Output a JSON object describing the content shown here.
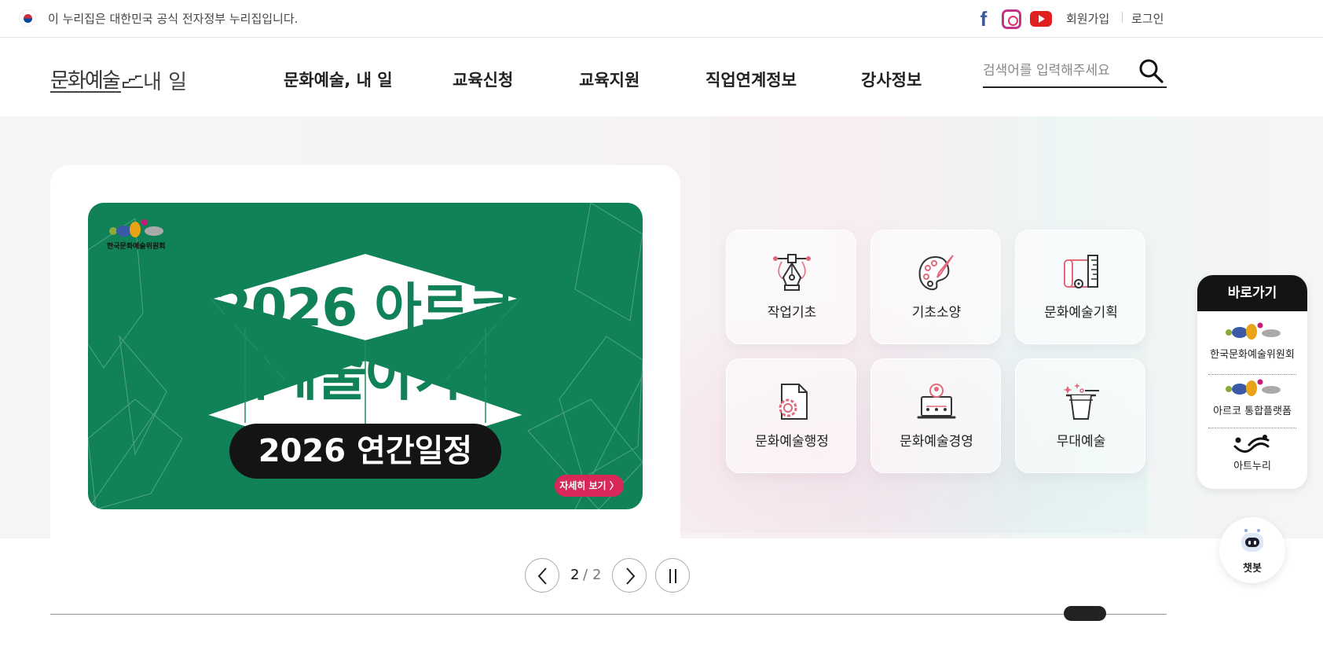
{
  "govbar": {
    "notice": "이 누리집은 대한민국 공식 전자정부 누리집입니다.",
    "sns": [
      "facebook-icon",
      "instagram-icon",
      "youtube-icon"
    ],
    "join_label": "회원가입",
    "login_label": "로그인"
  },
  "header": {
    "logo_text_1": "문화예술",
    "logo_text_2": "내 일",
    "nav": [
      "문화예술, 내 일",
      "교육신청",
      "교육지원",
      "직업연계정보",
      "강사정보"
    ],
    "search_placeholder": "검색어를 입력해주세요"
  },
  "banner": {
    "org_name": "한국문화예술위원회",
    "title_line1": "2026 아르코",
    "title_line2": "무대예술아카데미",
    "pill": "2026 연간일정",
    "more_label": "자세히 보기 〉",
    "background_color": "#118258"
  },
  "tiles": [
    {
      "label": "작업기초",
      "icon": "pen-tool-icon"
    },
    {
      "label": "기초소양",
      "icon": "palette-icon"
    },
    {
      "label": "문화예술기획",
      "icon": "blueprint-ruler-icon"
    },
    {
      "label": "문화예술행정",
      "icon": "document-gear-icon"
    },
    {
      "label": "문화예술경영",
      "icon": "person-laptop-icon"
    },
    {
      "label": "무대예술",
      "icon": "magic-hat-icon"
    }
  ],
  "quick": {
    "title": "바로가기",
    "items": [
      "한국문화예술위원회",
      "아르코 통합플랫폼",
      "아트누리"
    ]
  },
  "chatbot": {
    "label": "챗봇"
  },
  "pager": {
    "current": "2",
    "separator": "/",
    "total": "2",
    "progress": 0.96
  },
  "colors": {
    "accent_pink": "#d8285a",
    "dark": "#141414"
  }
}
